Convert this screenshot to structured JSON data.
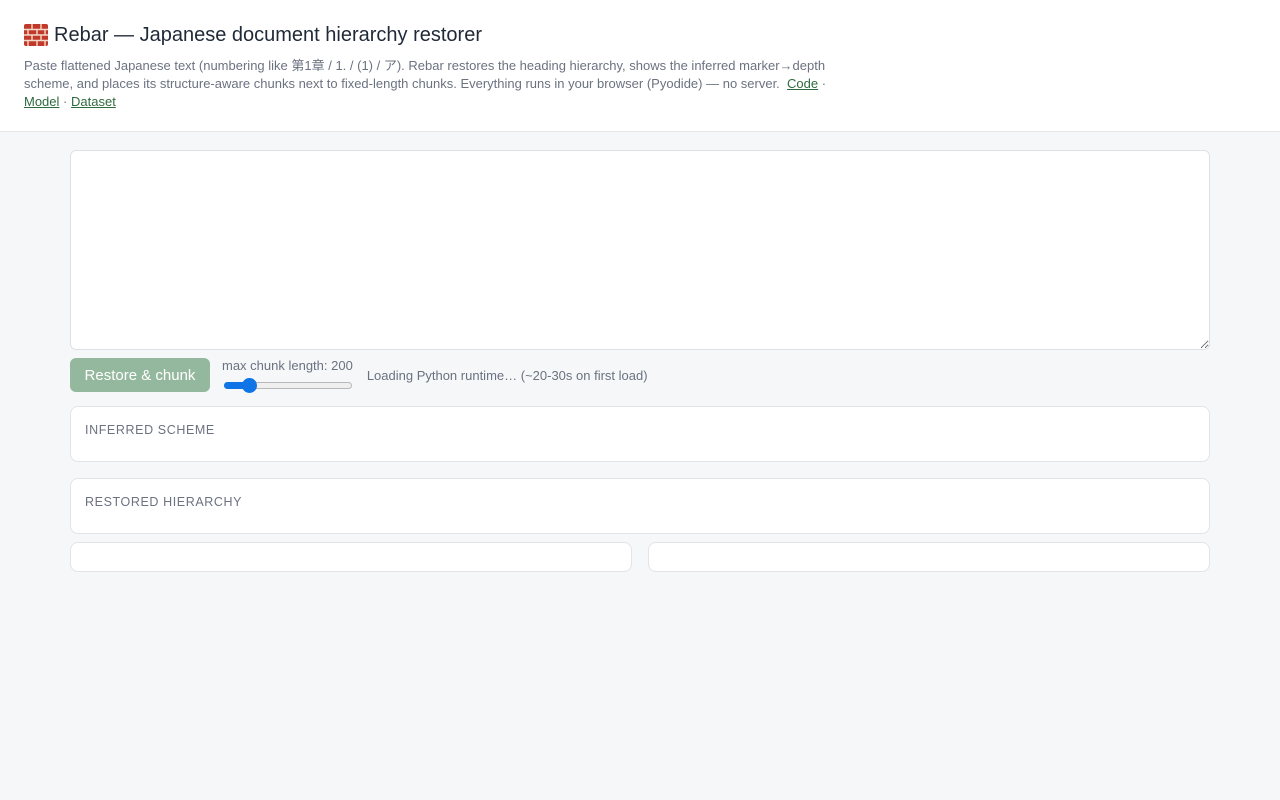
{
  "header": {
    "title": "Rebar — Japanese document hierarchy restorer",
    "icon": "brick-icon",
    "description": "Paste flattened Japanese text (numbering like 第1章 / 1. / (1) / ア). Rebar restores the heading hierarchy, shows the inferred marker→depth scheme, and places its structure-aware chunks next to fixed-length chunks. Everything runs in your browser (Pyodide) — no server.",
    "links": {
      "code": "Code",
      "model": "Model",
      "dataset": "Dataset",
      "separator": "·"
    }
  },
  "input": {
    "value": "",
    "placeholder": ""
  },
  "controls": {
    "run_button_label": "Restore & chunk",
    "slider_label": "max chunk length: 200",
    "slider": {
      "min": 50,
      "max": 1000,
      "value": 200
    },
    "status": "Loading Python runtime… (~20-30s on first load)"
  },
  "panels": {
    "scheme_title": "INFERRED SCHEME",
    "hierarchy_title": "RESTORED HIERARCHY"
  },
  "colors": {
    "accent": "#2f6b3f",
    "button_disabled": "#94b89e",
    "slider": "#0f74e6",
    "background": "#f5f7f9"
  }
}
